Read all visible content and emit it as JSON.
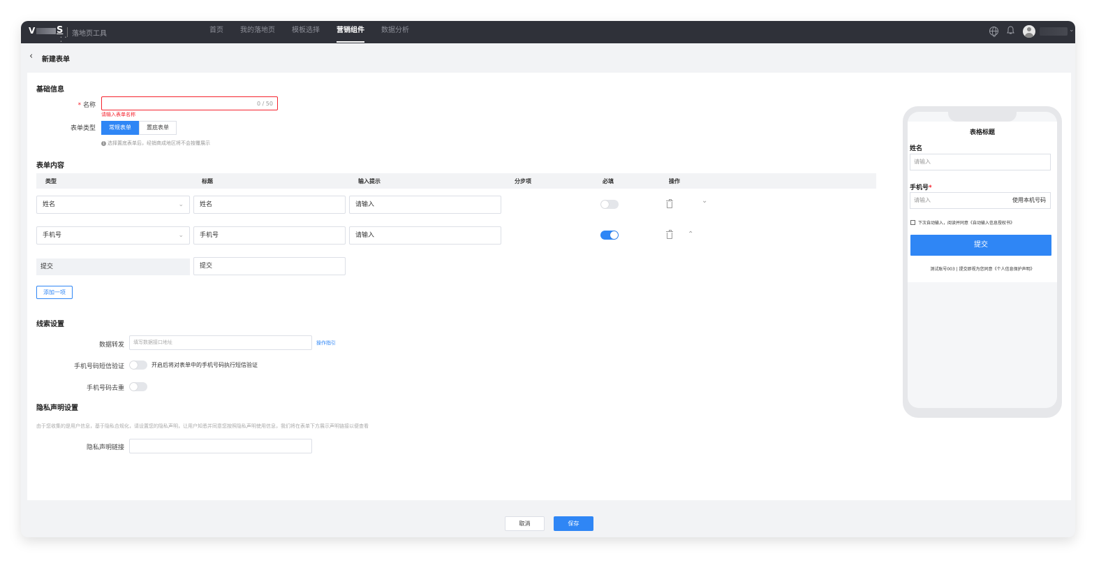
{
  "topbar": {
    "logo_v": "V",
    "logo_s": "S",
    "logo_dots": "• • •",
    "app_name": "落地页工具",
    "nav": [
      {
        "label": "首页"
      },
      {
        "label": "我的落地页"
      },
      {
        "label": "模板选择"
      },
      {
        "label": "营销组件",
        "active": true
      },
      {
        "label": "数据分析"
      }
    ],
    "bell_glyph": "🔔",
    "user_chevron": "⌄"
  },
  "page": {
    "back_glyph": "‹",
    "title": "新建表单"
  },
  "basic": {
    "section_title": "基础信息",
    "name_required_mark": "*",
    "name_label": "名称",
    "name_value": "",
    "name_counter": "0 / 50",
    "name_error": "请输入表单名称",
    "type_label": "表单类型",
    "type_options": [
      "常规表单",
      "置底表单"
    ],
    "type_selected": "常规表单",
    "type_hint": "选择置底表单后，经销商成地区将不会按覆展示"
  },
  "content": {
    "section_title": "表单内容",
    "columns": [
      "类型",
      "标题",
      "输入提示",
      "分步项",
      "必填",
      "操作"
    ],
    "rows": [
      {
        "type": "姓名",
        "title": "姓名",
        "placeholder": "请输入",
        "required": false,
        "arrow": "⌄"
      },
      {
        "type": "手机号",
        "title": "手机号",
        "placeholder": "请输入",
        "required": true,
        "arrow": "⌃"
      }
    ],
    "submit_row": {
      "type": "提交",
      "title": "提交"
    },
    "add_button": "添加一项"
  },
  "leads": {
    "section_title": "线索设置",
    "forward_label": "数据转发",
    "forward_placeholder": "填写数据接口地址",
    "forward_link": "操作指引",
    "sms_label": "手机号码短信验证",
    "sms_desc": "开启后将对表单中的手机号码执行短信验证",
    "sms_on": false,
    "dedupe_label": "手机号码去重",
    "dedupe_on": false
  },
  "privacy": {
    "section_title": "隐私声明设置",
    "description": "由于您收集的是用户信息，基于隐私合规化，请设置您的隐私声明，让用户知悉并同意您按照隐私声明使用信息，我们将在表单下方展示声明链接以便查看",
    "link_label": "隐私声明链接",
    "link_value": ""
  },
  "preview": {
    "title": "表格标题",
    "name_label": "姓名",
    "name_placeholder": "请输入",
    "phone_label": "手机号",
    "phone_required_mark": "*",
    "phone_placeholder": "请输入",
    "use_my_number": "使用本机号码",
    "auto_fill_text": "下次自动输入，阅读并同意《自动输入信息授权书》",
    "submit": "提交",
    "footer": "测试账号003 | 提交即视为您同意《个人信息保护声明》"
  },
  "footer": {
    "cancel": "取消",
    "save": "保存"
  },
  "colors": {
    "primary": "#2f86f5",
    "topbar": "#2f3139",
    "error": "#f5222d"
  }
}
